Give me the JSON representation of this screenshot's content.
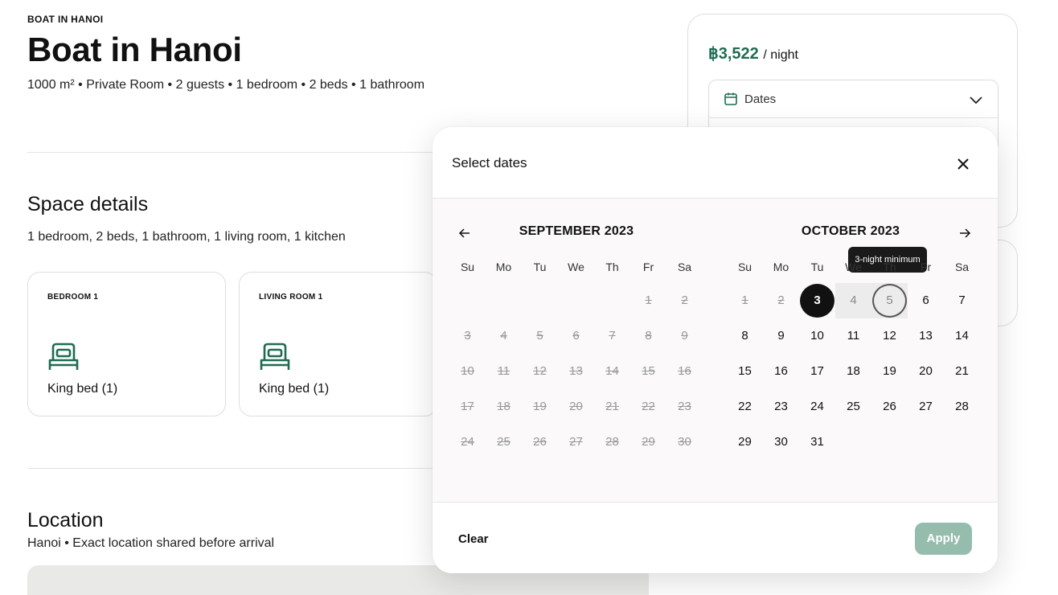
{
  "listing": {
    "eyebrow": "BOAT IN HANOI",
    "title": "Boat in Hanoi",
    "summary": "1000 m² • Private Room • 2 guests • 1 bedroom • 2 beds • 1 bathroom"
  },
  "space": {
    "heading": "Space details",
    "summary": "1 bedroom, 2 beds, 1 bathroom, 1 living room, 1 kitchen",
    "rooms": [
      {
        "label": "BEDROOM 1",
        "bed": "King bed (1)",
        "icon": "bed-icon"
      },
      {
        "label": "LIVING ROOM 1",
        "bed": "King bed (1)",
        "icon": "bed-icon"
      }
    ]
  },
  "location": {
    "heading": "Location",
    "summary": "Hanoi • Exact location shared before arrival"
  },
  "booking": {
    "price": "฿3,522",
    "per": "/ night",
    "dates_label": "Dates",
    "accent": "#1f6b53"
  },
  "modal": {
    "title": "Select dates",
    "clear_label": "Clear",
    "apply_label": "Apply",
    "tooltip": "3-night minimum",
    "weekdays": [
      "Su",
      "Mo",
      "Tu",
      "We",
      "Th",
      "Fr",
      "Sa"
    ],
    "months": [
      {
        "title": "SEPTEMBER 2023",
        "first_weekday": 5,
        "days": 30,
        "past_through": 30
      },
      {
        "title": "OCTOBER 2023",
        "first_weekday": 0,
        "days": 31,
        "past_through": 2,
        "selected": 3,
        "range": [
          4
        ],
        "hover": 5
      }
    ]
  }
}
